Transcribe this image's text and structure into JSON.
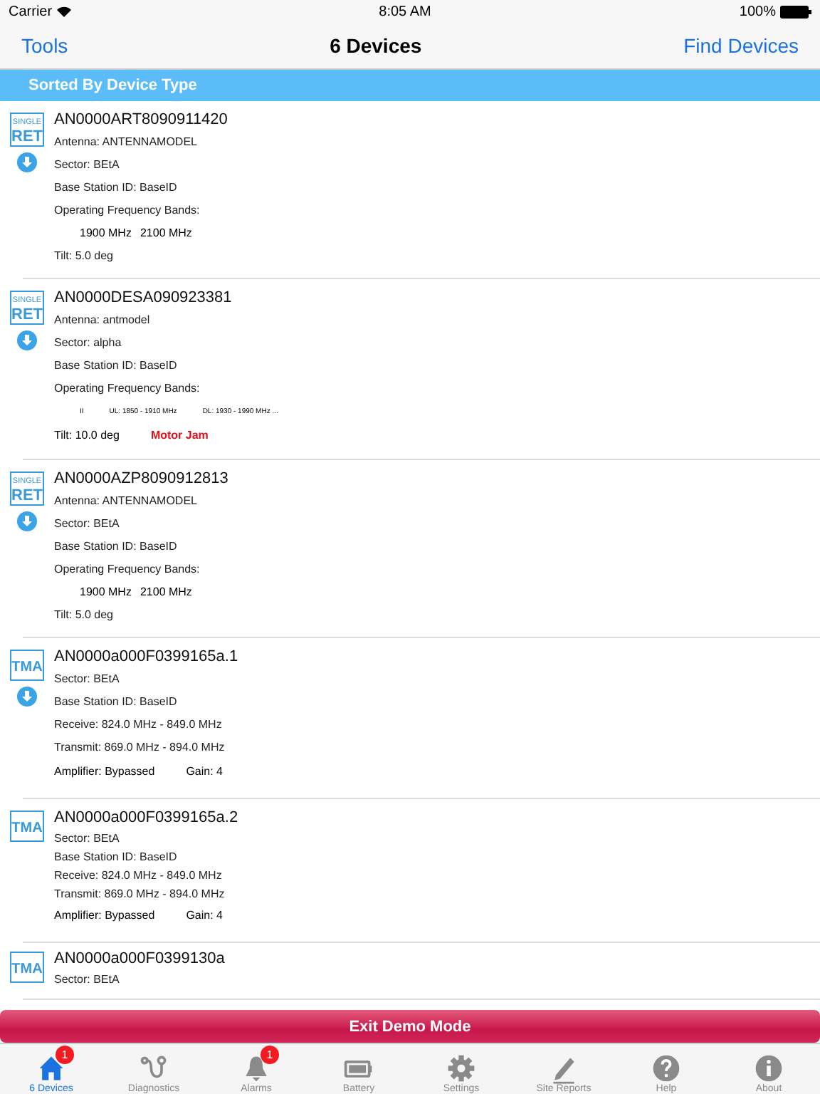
{
  "status_bar": {
    "carrier": "Carrier",
    "time": "8:05 AM",
    "battery": "100%"
  },
  "nav": {
    "left": "Tools",
    "title": "6 Devices",
    "right": "Find Devices"
  },
  "section_header": "Sorted By Device Type",
  "devices": [
    {
      "kind": "ret",
      "icon_text": [
        "SINGLE",
        "RET"
      ],
      "download": true,
      "id": "AN0000ART8090911420",
      "lines": [
        {
          "kind": "text",
          "text": "Antenna: ANTENNAMODEL"
        },
        {
          "kind": "text",
          "text": "Sector: BEtA"
        },
        {
          "kind": "text",
          "text": "Base Station ID: BaseID"
        },
        {
          "kind": "text",
          "text": "Operating Frequency Bands:"
        },
        {
          "kind": "bands",
          "items": [
            "1900 MHz",
            "2100 MHz"
          ]
        },
        {
          "kind": "text",
          "text": "Tilt: 5.0 deg"
        }
      ]
    },
    {
      "kind": "ret",
      "icon_text": [
        "SINGLE",
        "RET"
      ],
      "download": true,
      "id": "AN0000DESA090923381",
      "lines": [
        {
          "kind": "text",
          "text": "Antenna: antmodel"
        },
        {
          "kind": "text",
          "text": "Sector: alpha"
        },
        {
          "kind": "text",
          "text": "Base Station ID: BaseID"
        },
        {
          "kind": "text",
          "text": "Operating Frequency Bands:"
        },
        {
          "kind": "smallbands",
          "items": [
            "II",
            "UL: 1850 - 1910 MHz",
            "DL: 1930 - 1990 MHz ..."
          ]
        },
        {
          "kind": "alert",
          "text": "Tilt: 10.0 deg",
          "alert": "Motor Jam"
        }
      ]
    },
    {
      "kind": "ret",
      "icon_text": [
        "SINGLE",
        "RET"
      ],
      "download": true,
      "id": "AN0000AZP8090912813",
      "lines": [
        {
          "kind": "text",
          "text": "Antenna: ANTENNAMODEL"
        },
        {
          "kind": "text",
          "text": "Sector: BEtA"
        },
        {
          "kind": "text",
          "text": "Base Station ID: BaseID"
        },
        {
          "kind": "text",
          "text": "Operating Frequency Bands:"
        },
        {
          "kind": "bands",
          "items": [
            "1900 MHz",
            "2100 MHz"
          ]
        },
        {
          "kind": "text",
          "text": "Tilt: 5.0 deg"
        }
      ]
    },
    {
      "kind": "tma",
      "icon_text": [
        "TMA"
      ],
      "download": true,
      "id": "AN0000a000F0399165a.1",
      "lines": [
        {
          "kind": "text",
          "text": "Sector: BEtA"
        },
        {
          "kind": "text",
          "text": "Base Station ID: BaseID"
        },
        {
          "kind": "text",
          "text": "Receive: 824.0 MHz -  849.0 MHz"
        },
        {
          "kind": "text",
          "text": "Transmit: 869.0 MHz -  894.0 MHz"
        },
        {
          "kind": "pair",
          "items": [
            "Amplifier: Bypassed",
            "Gain: 4"
          ]
        }
      ]
    },
    {
      "kind": "tma",
      "icon_text": [
        "TMA"
      ],
      "download": false,
      "id": "AN0000a000F0399165a.2",
      "lines": [
        {
          "kind": "tight",
          "text": "Sector: BEtA"
        },
        {
          "kind": "tight",
          "text": "Base Station ID: BaseID"
        },
        {
          "kind": "tight",
          "text": "Receive: 824.0 MHz -  849.0 MHz"
        },
        {
          "kind": "tight",
          "text": "Transmit: 869.0 MHz -  894.0 MHz"
        },
        {
          "kind": "pair",
          "items": [
            "Amplifier: Bypassed",
            "Gain: 4"
          ]
        }
      ]
    },
    {
      "kind": "tma",
      "icon_text": [
        "TMA"
      ],
      "download": false,
      "id": "AN0000a000F0399130a",
      "lines": [
        {
          "kind": "tight",
          "text": "Sector: BEtA"
        }
      ]
    }
  ],
  "exit_button": "Exit Demo Mode",
  "tabs": [
    {
      "label": "6 Devices",
      "selected": true,
      "badge": "1"
    },
    {
      "label": "Diagnostics",
      "selected": false
    },
    {
      "label": "Alarms",
      "selected": false,
      "badge": "1"
    },
    {
      "label": "Battery",
      "selected": false
    },
    {
      "label": "Settings",
      "selected": false
    },
    {
      "label": "Site Reports",
      "selected": false
    },
    {
      "label": "Help",
      "selected": false
    },
    {
      "label": "About",
      "selected": false
    }
  ]
}
